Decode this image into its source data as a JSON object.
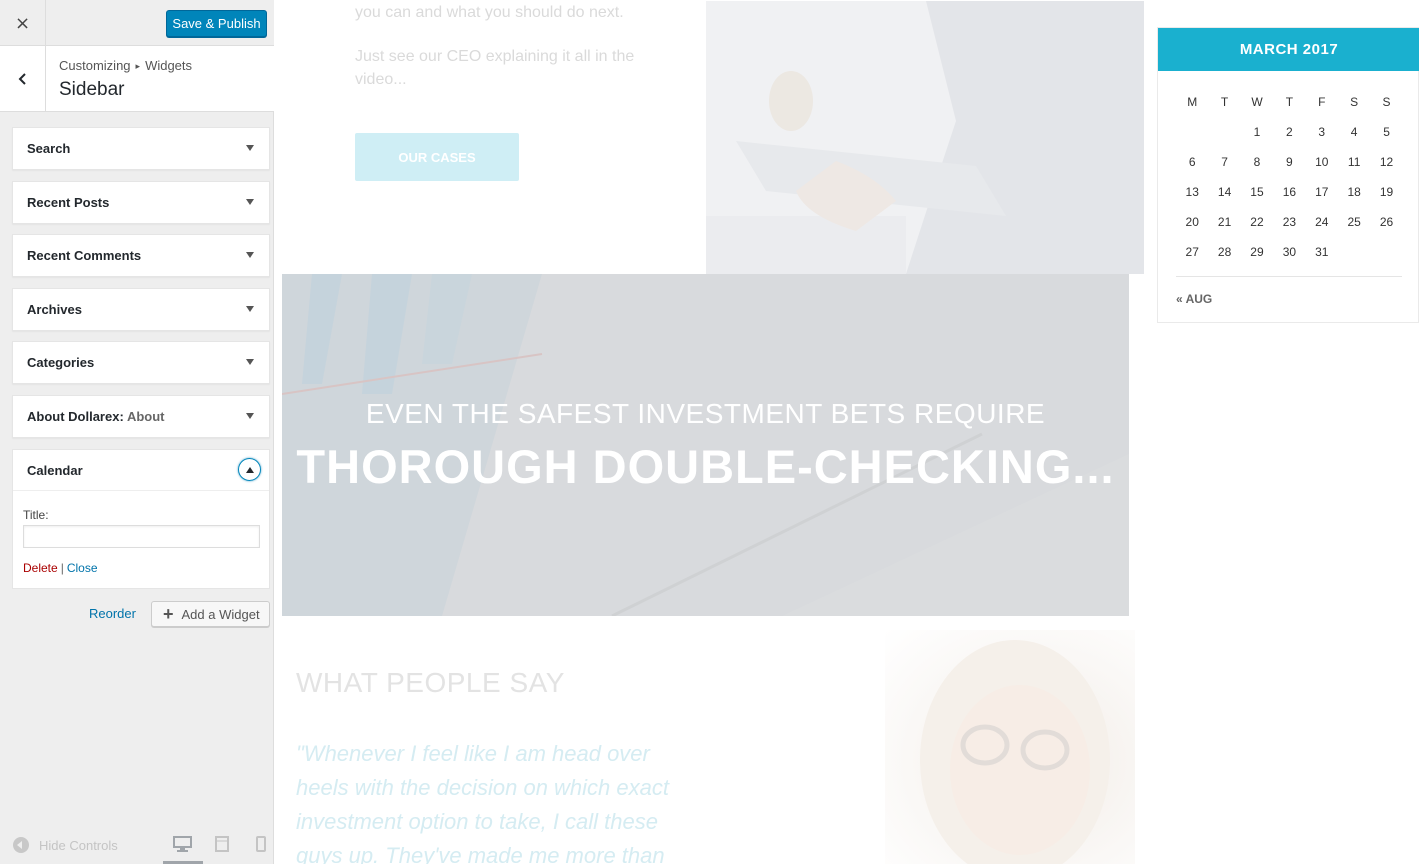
{
  "customizer": {
    "close_icon": "×",
    "save_label": "Save & Publish",
    "breadcrumb": [
      "Customizing",
      "Widgets"
    ],
    "breadcrumb_separator": "▸",
    "section_title": "Sidebar",
    "widgets": [
      {
        "title": "Search"
      },
      {
        "title": "Recent Posts"
      },
      {
        "title": "Recent Comments"
      },
      {
        "title": "Archives"
      },
      {
        "title": "Categories"
      },
      {
        "title": "About Dollarex:",
        "subtitle": "About"
      }
    ],
    "open_widget": {
      "title": "Calendar",
      "field_label": "Title:",
      "field_value": "",
      "delete_label": "Delete",
      "separator": "|",
      "close_label": "Close"
    },
    "reorder_label": "Reorder",
    "add_widget_label": "Add a Widget",
    "hide_controls_label": "Hide Controls"
  },
  "preview": {
    "intro_line": "you can and what you should do next.",
    "intro_p2_line1": "Just see our CEO explaining it all in the",
    "intro_p2_line2": "video...",
    "cta_label": "OUR CASES",
    "banner_line1": "EVEN THE SAFEST INVESTMENT BETS REQUIRE",
    "banner_line2": "THOROUGH DOUBLE-CHECKING...",
    "testimonials_title": "WHAT PEOPLE SAY",
    "quote_lines": [
      "\"Whenever I feel like I am head over",
      "heels with the decision on which exact",
      "investment option to take, I call these",
      "guys up. They've made me more than"
    ],
    "calendar": {
      "month": "MARCH 2017",
      "weekdays": [
        "M",
        "T",
        "W",
        "T",
        "F",
        "S",
        "S"
      ],
      "weeks": [
        [
          "",
          "",
          "1",
          "2",
          "3",
          "4",
          "5"
        ],
        [
          "6",
          "7",
          "8",
          "9",
          "10",
          "11",
          "12"
        ],
        [
          "13",
          "14",
          "15",
          "16",
          "17",
          "18",
          "19"
        ],
        [
          "20",
          "21",
          "22",
          "23",
          "24",
          "25",
          "26"
        ],
        [
          "27",
          "28",
          "29",
          "30",
          "31",
          "",
          ""
        ]
      ],
      "prev_link": "« AUG"
    }
  },
  "colors": {
    "primary_button": "#0085ba",
    "calendar_header": "#1ab0cf",
    "link": "#0073aa",
    "delete": "#aa0000"
  }
}
